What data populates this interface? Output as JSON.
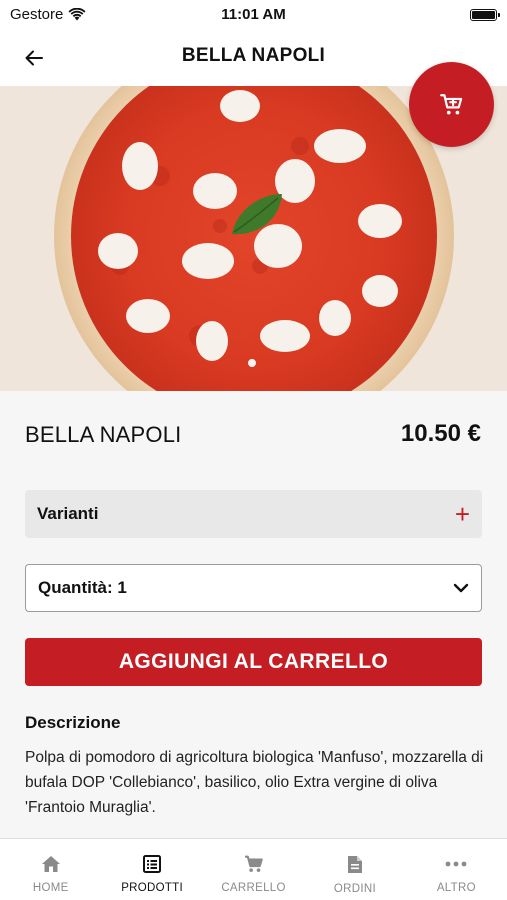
{
  "status_bar": {
    "carrier": "Gestore",
    "time": "11:01 AM"
  },
  "nav": {
    "title": "BELLA NAPOLI"
  },
  "product": {
    "name": "BELLA NAPOLI",
    "price": "10.50 €",
    "variants_label": "Varianti",
    "quantity_label": "Quantità: 1",
    "add_to_cart_label": "AGGIUNGI AL CARRELLO",
    "description_title": "Descrizione",
    "description": "Polpa di pomodoro di agricoltura biologica 'Manfuso', mozzarella di bufala DOP 'Collebianco', basilico, olio Extra vergine di oliva 'Frantoio Muraglia'."
  },
  "tabs": [
    {
      "label": "HOME",
      "icon": "home-icon"
    },
    {
      "label": "PRODOTTI",
      "icon": "list-icon"
    },
    {
      "label": "CARRELLO",
      "icon": "cart-icon"
    },
    {
      "label": "ORDINI",
      "icon": "document-icon"
    },
    {
      "label": "ALTRO",
      "icon": "more-icon"
    }
  ],
  "active_tab": "PRODOTTI",
  "colors": {
    "accent": "#c41e24",
    "background": "#f6f6f6",
    "field_bg": "#e8e8e8"
  }
}
